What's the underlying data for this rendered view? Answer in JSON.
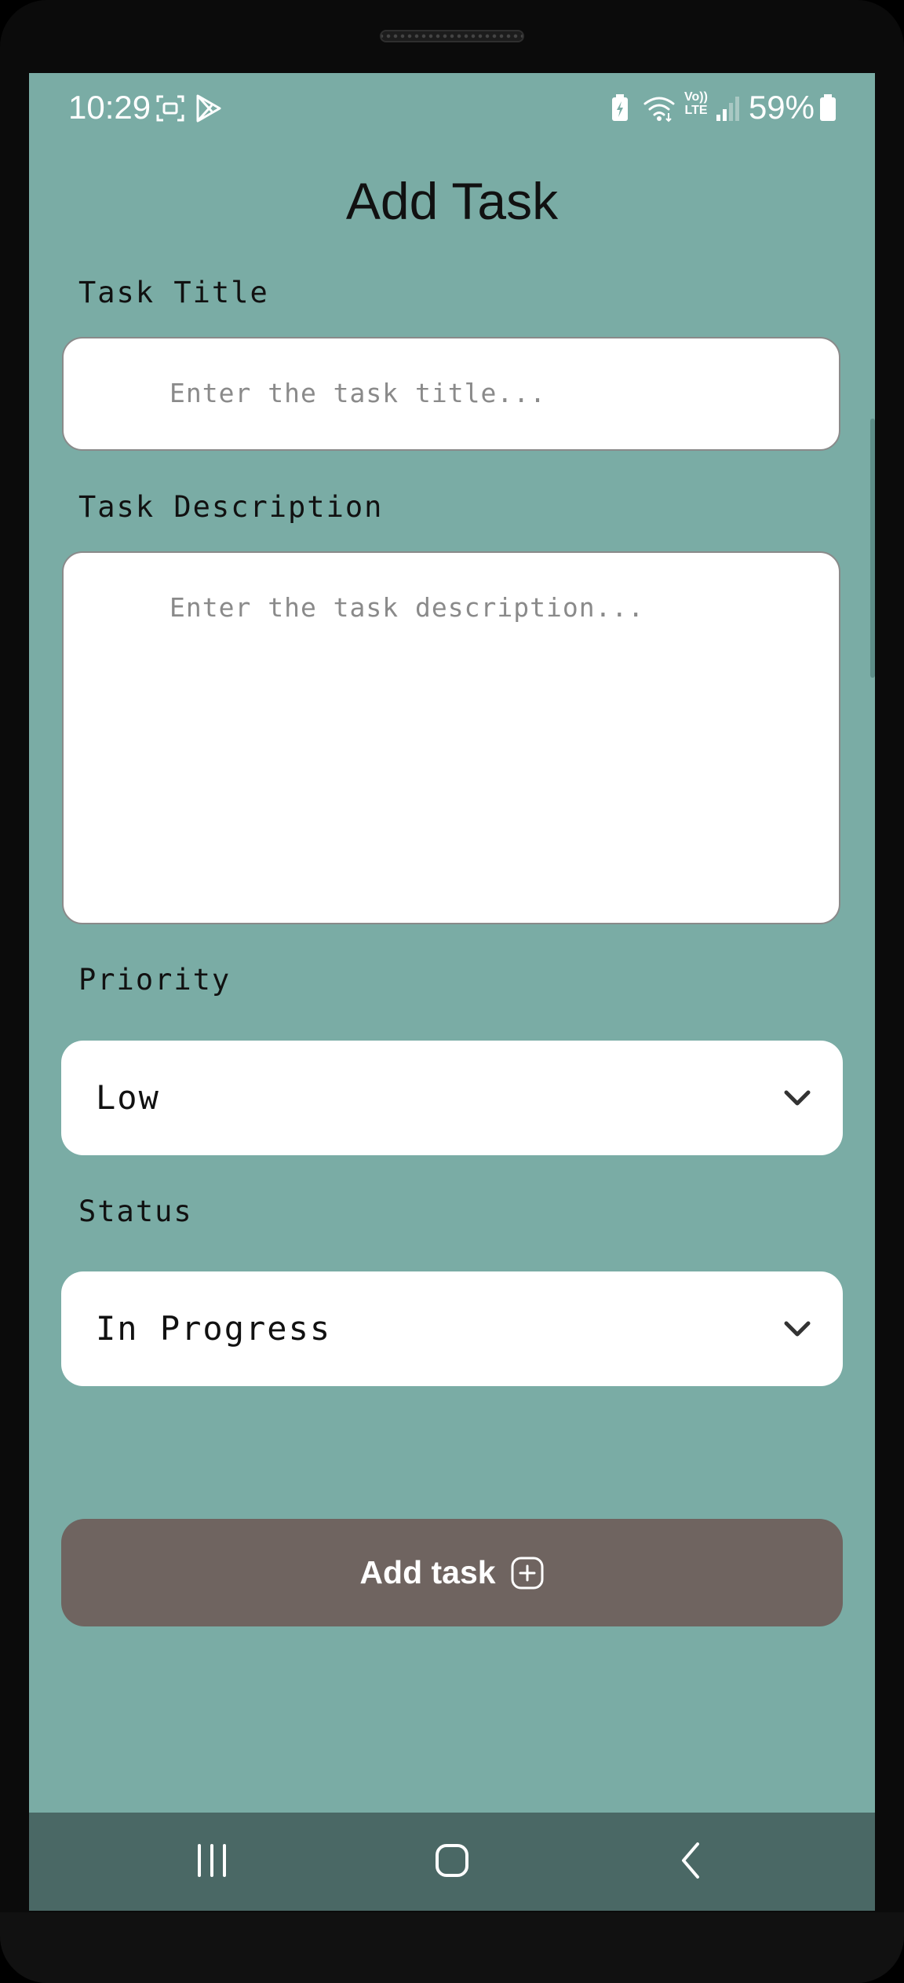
{
  "status_bar": {
    "time": "10:29",
    "battery_percent": "59%",
    "icons": [
      "screenshot-icon",
      "play-store-icon",
      "battery-saver-icon",
      "wifi-icon",
      "volte-icon",
      "signal-icon",
      "battery-icon"
    ],
    "volte_text": "Vo)) LTE"
  },
  "page": {
    "title": "Add Task"
  },
  "form": {
    "task_title_label": "Task Title",
    "task_title_placeholder": "Enter the task title...",
    "task_description_label": "Task Description",
    "task_description_placeholder": "Enter the task description...",
    "priority_label": "Priority",
    "priority_value": "Low",
    "status_label": "Status",
    "status_value": "In Progress",
    "submit_label": "Add task",
    "submit_icon": "add-square-icon"
  },
  "nav_bar": {
    "buttons": [
      "recents-icon",
      "home-icon",
      "back-icon"
    ]
  },
  "colors": {
    "background": "#7aaca5",
    "button": "#6f6460",
    "nav_bar": "#4a6865"
  }
}
